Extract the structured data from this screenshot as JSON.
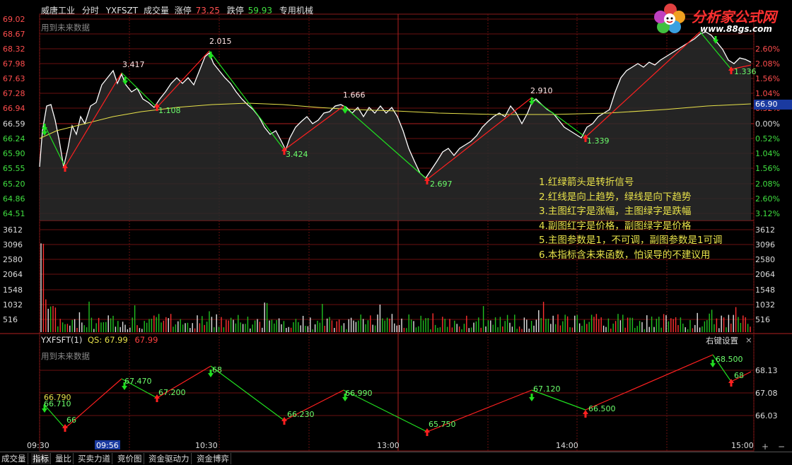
{
  "header": {
    "stock_name": "威唐工业",
    "mode": "分时",
    "indicator": "YXFSZT",
    "volume_label": "成交量",
    "limit_up_label": "涨停",
    "limit_up_value": "73.25",
    "limit_down_label": "跌停",
    "limit_down_value": "59.93",
    "sector": "专用机械"
  },
  "future_warning_main": "用到未来数据",
  "future_warning_sub": "用到未来数据",
  "current_price": "66.90",
  "price_axis": [
    "69.02",
    "68.67",
    "68.32",
    "67.98",
    "67.63",
    "67.28",
    "66.94",
    "66.59",
    "66.24",
    "65.90",
    "65.55",
    "65.20",
    "64.86",
    "64.51"
  ],
  "pct_axis": [
    "2.60%",
    "2.08%",
    "1.56%",
    "1.04%",
    "0.52%",
    "0.00%",
    "0.52%",
    "1.04%",
    "1.56%",
    "2.08%",
    "2.60%",
    "3.12%"
  ],
  "volume_axis": [
    "3612",
    "3096",
    "2580",
    "2064",
    "1548",
    "1032",
    "516"
  ],
  "sub_axis": [
    "68.13",
    "67.08",
    "66.03"
  ],
  "time_axis": [
    "09:30",
    "10:30",
    "13:00",
    "14:00",
    "15:00"
  ],
  "time_cursor": "09:56",
  "main_labels": [
    {
      "text": "3.417",
      "color": "#ffe6e6"
    },
    {
      "text": "2.015",
      "color": "#ffe6e6"
    },
    {
      "text": "1.666",
      "color": "#ffe6e6"
    },
    {
      "text": "2.910",
      "color": "#ffe6e6"
    },
    {
      "text": "1.108",
      "color": "#6cff6c"
    },
    {
      "text": "3.424",
      "color": "#6cff6c"
    },
    {
      "text": "2.697",
      "color": "#6cff6c"
    },
    {
      "text": "1.339",
      "color": "#6cff6c"
    },
    {
      "text": "1.336",
      "color": "#6cff6c"
    }
  ],
  "sub_header": {
    "name": "YXFSFT(1)",
    "qs_label": "QS:",
    "qs_value": "67.99",
    "value2": "67.99"
  },
  "sub_labels": [
    {
      "text": "66.790",
      "color": "#e8e24a"
    },
    {
      "text": "66.710",
      "color": "#6cff6c"
    },
    {
      "text": "66",
      "color": "#6cff6c"
    },
    {
      "text": "67.470",
      "color": "#6cff6c"
    },
    {
      "text": "67.200",
      "color": "#6cff6c"
    },
    {
      "text": "68",
      "color": "#6cff6c"
    },
    {
      "text": "66.230",
      "color": "#6cff6c"
    },
    {
      "text": "66.990",
      "color": "#6cff6c"
    },
    {
      "text": "65.750",
      "color": "#6cff6c"
    },
    {
      "text": "67.120",
      "color": "#6cff6c"
    },
    {
      "text": "66.500",
      "color": "#6cff6c"
    },
    {
      "text": "68.500",
      "color": "#6cff6c"
    },
    {
      "text": "68",
      "color": "#6cff6c"
    }
  ],
  "notes": [
    "1.红绿箭头是转折信号",
    "2.红线是向上趋势，绿线是向下趋势",
    "3.主图红字是涨幅，主图绿字是跌幅",
    "4.副图红字是价格，副图绿字是价格",
    "5.主图参数是1，不可调，副图参数是1可调",
    "6.本指标含未来函数，怕误导的不建议用"
  ],
  "right_menu": "右键设置",
  "right_menu_close": "×",
  "tabs": [
    "成交量",
    "指标",
    "量比",
    "买卖力道",
    "竞价图",
    "资金驱动力",
    "资金博弈"
  ],
  "scroll_plus": "+",
  "scroll_minus": "−",
  "logo": {
    "title": "分析家公式网",
    "url": "www.88gs.com"
  }
}
